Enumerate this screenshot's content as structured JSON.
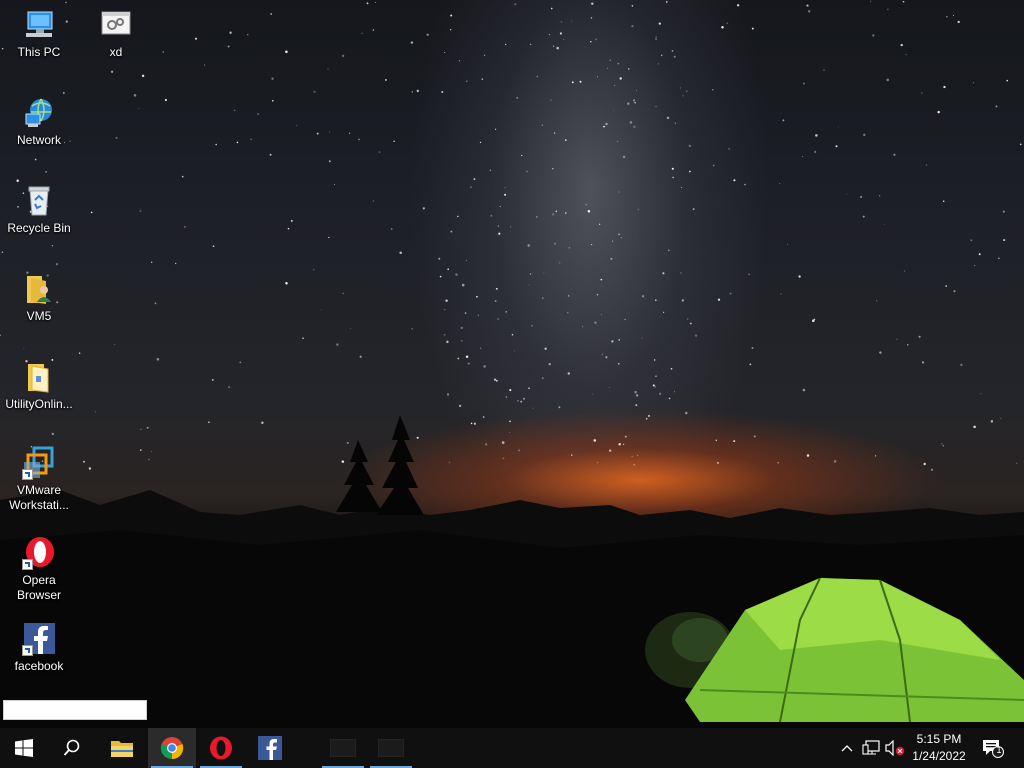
{
  "desktop": {
    "icons": [
      {
        "label": "This PC",
        "icon": "computer-icon"
      },
      {
        "label": "xd",
        "icon": "settings-file-icon"
      },
      {
        "label": "Network",
        "icon": "network-icon"
      },
      {
        "label": "Recycle Bin",
        "icon": "recycle-bin-icon"
      },
      {
        "label": "VM5",
        "icon": "user-folder-icon"
      },
      {
        "label": "UtilityOnlin...",
        "icon": "document-folder-icon"
      },
      {
        "label": "VMware Workstati...",
        "icon": "vmware-icon"
      },
      {
        "label": "Opera Browser",
        "icon": "opera-icon"
      },
      {
        "label": "facebook",
        "icon": "facebook-icon"
      }
    ],
    "rename_value": ""
  },
  "taskbar": {
    "items": [
      {
        "name": "start",
        "icon": "windows-logo-icon"
      },
      {
        "name": "search",
        "icon": "search-icon"
      },
      {
        "name": "file-explorer",
        "icon": "folder-icon"
      },
      {
        "name": "chrome",
        "icon": "chrome-icon",
        "active": true,
        "running": true
      },
      {
        "name": "opera",
        "icon": "opera-icon",
        "running": true
      },
      {
        "name": "facebook",
        "icon": "facebook-icon"
      },
      {
        "name": "window-1",
        "icon": "window-thumbnail-icon",
        "running": true
      },
      {
        "name": "window-2",
        "icon": "window-thumbnail-icon",
        "running": true
      }
    ],
    "tray": {
      "time": "5:15 PM",
      "date": "1/24/2022",
      "notification_count": "1"
    }
  },
  "colors": {
    "taskbar": "#101010",
    "accent": "#6fa8dc",
    "tent": "#8fd13a",
    "horizon_glow": "#eb691e"
  }
}
